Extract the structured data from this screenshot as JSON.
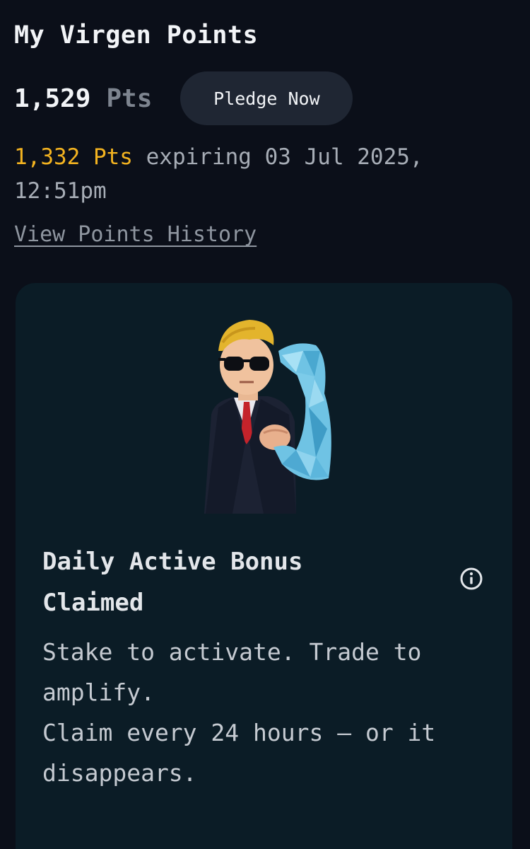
{
  "header": {
    "title": "My Virgen Points"
  },
  "points": {
    "total_value": "1,529",
    "total_unit": "Pts",
    "pledge_label": "Pledge Now"
  },
  "expiry": {
    "amount": "1,332 Pts",
    "text": " expiring 03 Jul 2025, 12:51pm"
  },
  "history_link": "View Points History",
  "bonus_card": {
    "title": "Daily Active Bonus Claimed",
    "desc_line1": "Stake to activate. Trade to amplify.",
    "desc_line2": "Claim every 24 hours — or it disappears."
  },
  "colors": {
    "background": "#0b0f19",
    "card_background": "#0b1c26",
    "accent_amount": "#f3b320",
    "button_background": "#1f2633"
  }
}
